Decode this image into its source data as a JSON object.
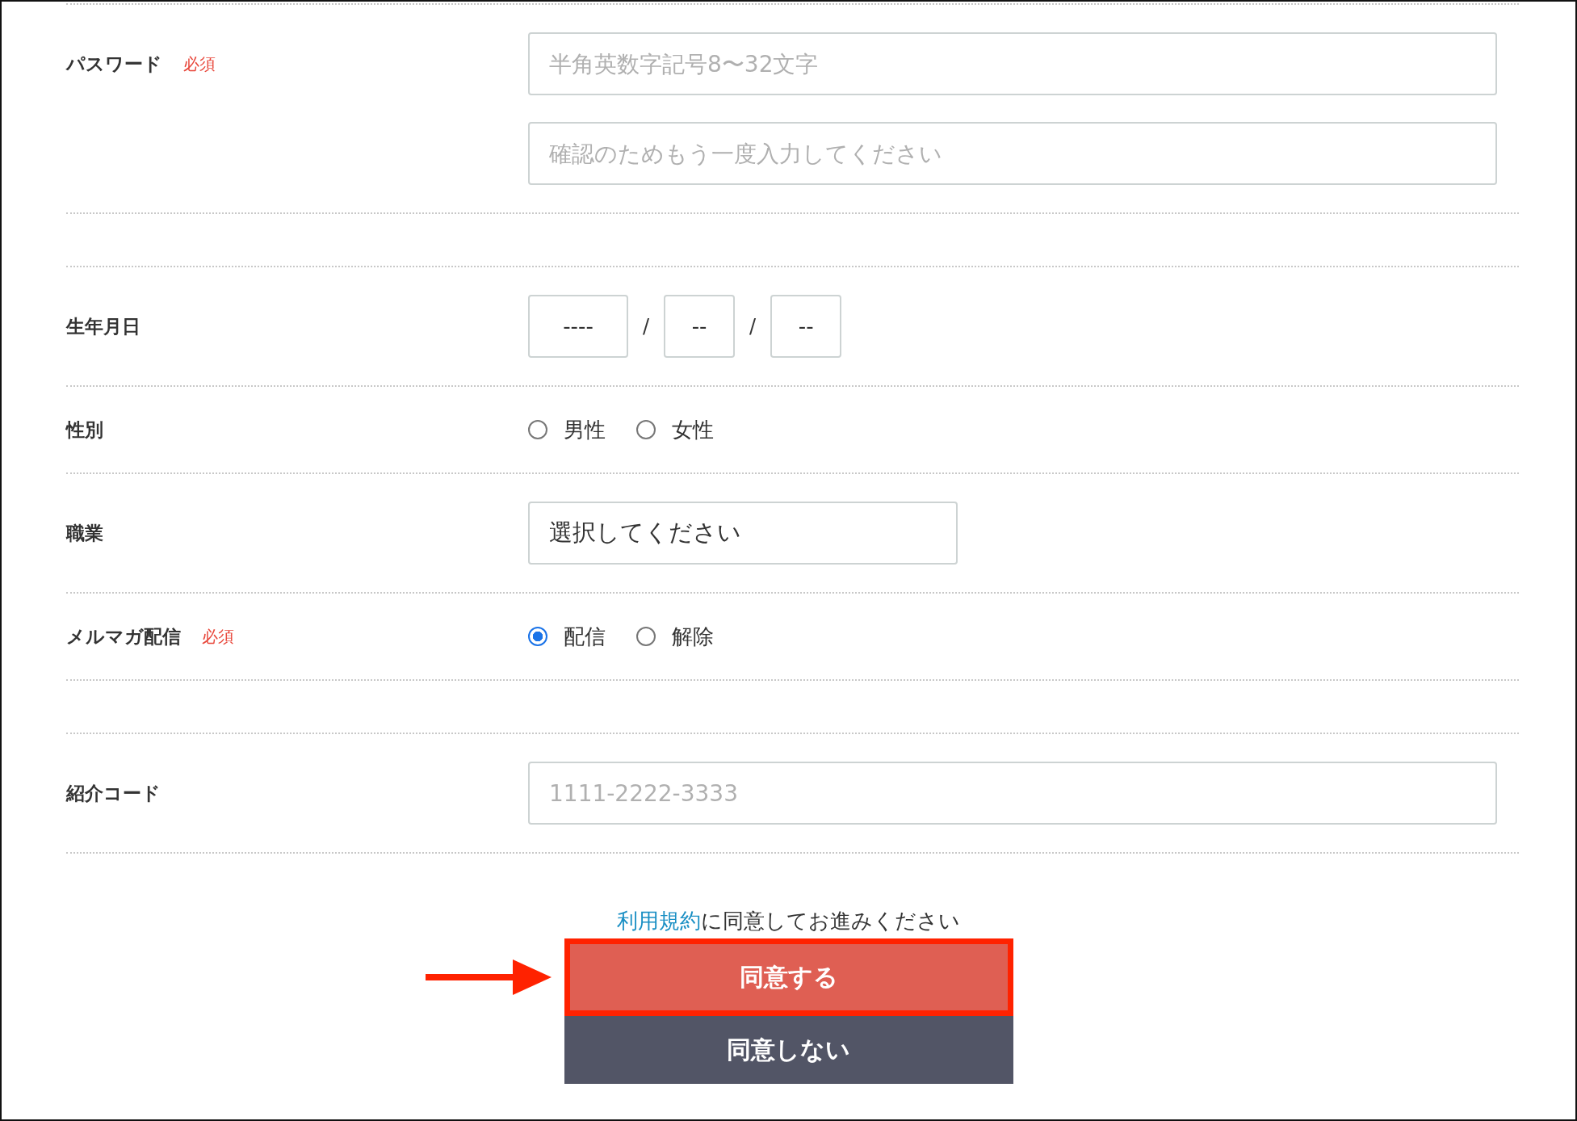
{
  "rows": [
    {
      "kind": "inputs",
      "label": "パスワード",
      "required_badge": "必須",
      "fields": [
        {
          "placeholder": "半角英数字記号8〜32文字"
        },
        {
          "placeholder": "確認のためもう一度入力してください"
        }
      ]
    },
    {
      "kind": "blank"
    },
    {
      "kind": "date",
      "label": "生年月日",
      "fields": [
        {
          "value": "----"
        },
        {
          "value": "--"
        },
        {
          "value": "--"
        }
      ],
      "separators": [
        "/",
        "/"
      ]
    },
    {
      "kind": "radio",
      "label": "性別",
      "options": [
        {
          "label": "男性",
          "selected": false
        },
        {
          "label": "女性",
          "selected": false
        }
      ]
    },
    {
      "kind": "select",
      "label": "職業",
      "value": "選択してください"
    },
    {
      "kind": "radio",
      "label": "メルマガ配信",
      "required_badge": "必須",
      "options": [
        {
          "label": "配信",
          "selected": true
        },
        {
          "label": "解除",
          "selected": false
        }
      ]
    },
    {
      "kind": "blank"
    },
    {
      "kind": "inputs",
      "label": "紹介コード",
      "fields": [
        {
          "placeholder": "1111-2222-3333"
        }
      ]
    }
  ],
  "terms": {
    "link": "利用規約",
    "text": "に同意してお進みください"
  },
  "buttons": [
    {
      "kind": "agree",
      "label": "同意する",
      "highlighted": true
    },
    {
      "kind": "decline",
      "label": "同意しない",
      "highlighted": false
    }
  ]
}
